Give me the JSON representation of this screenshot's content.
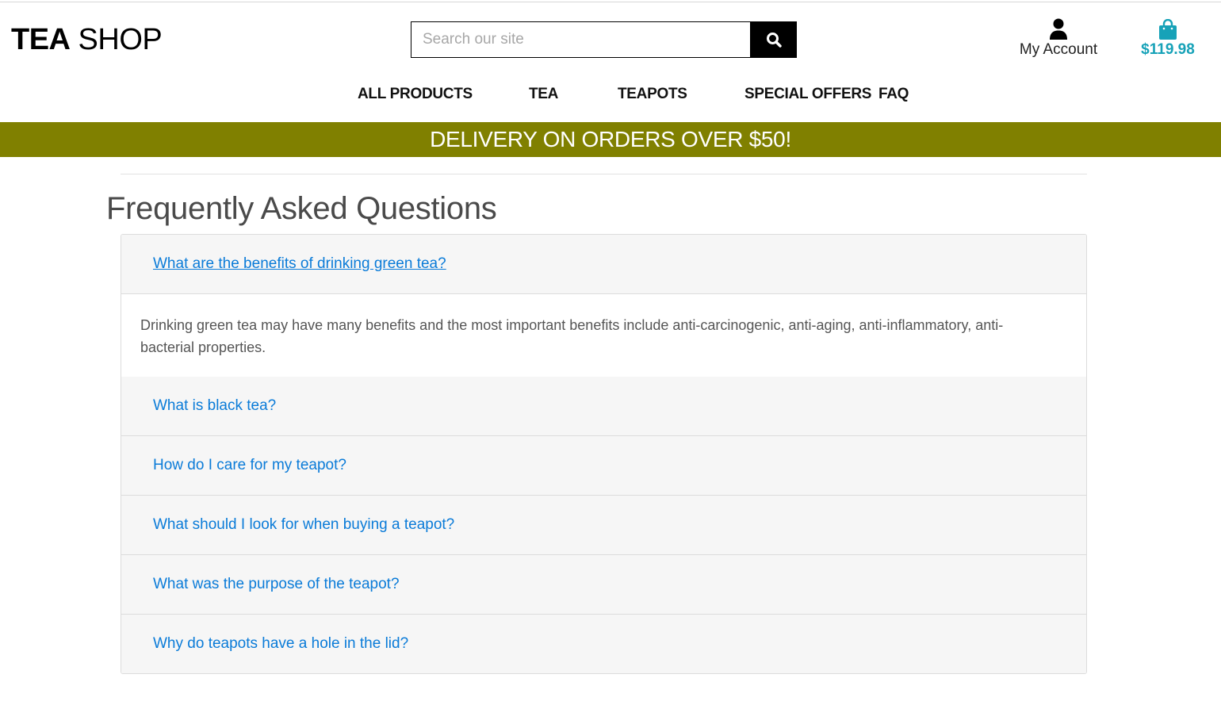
{
  "header": {
    "logo_bold": "TEA",
    "logo_light": " SHOP",
    "search_placeholder": "Search our site",
    "account_label": "My Account",
    "cart_total": "$119.98"
  },
  "nav": {
    "items": [
      {
        "label": "ALL PRODUCTS"
      },
      {
        "label": "TEA"
      },
      {
        "label": "TEAPOTS"
      },
      {
        "label": "SPECIAL OFFERS"
      },
      {
        "label": "FAQ"
      }
    ]
  },
  "banner": {
    "text": "DELIVERY ON ORDERS OVER $50!"
  },
  "faq": {
    "title": "Frequently Asked Questions",
    "items": [
      {
        "question": "What are the benefits of drinking green tea?",
        "answer": "Drinking green tea may have many benefits and the most important benefits include anti-carcinogenic, anti-aging, anti-inflammatory, anti-bacterial properties.",
        "expanded": true
      },
      {
        "question": "What is black tea?",
        "expanded": false
      },
      {
        "question": "How do I care for my teapot?",
        "expanded": false
      },
      {
        "question": "What should I look for when buying a teapot?",
        "expanded": false
      },
      {
        "question": "What was the purpose of the teapot?",
        "expanded": false
      },
      {
        "question": "Why do teapots have a hole in the lid?",
        "expanded": false
      }
    ]
  },
  "icons": {
    "search": "search-icon",
    "account": "user-icon",
    "cart": "shopping-bag-icon"
  },
  "colors": {
    "banner": "#808000",
    "link": "#0a7bd8",
    "cart": "#17a2b8"
  }
}
